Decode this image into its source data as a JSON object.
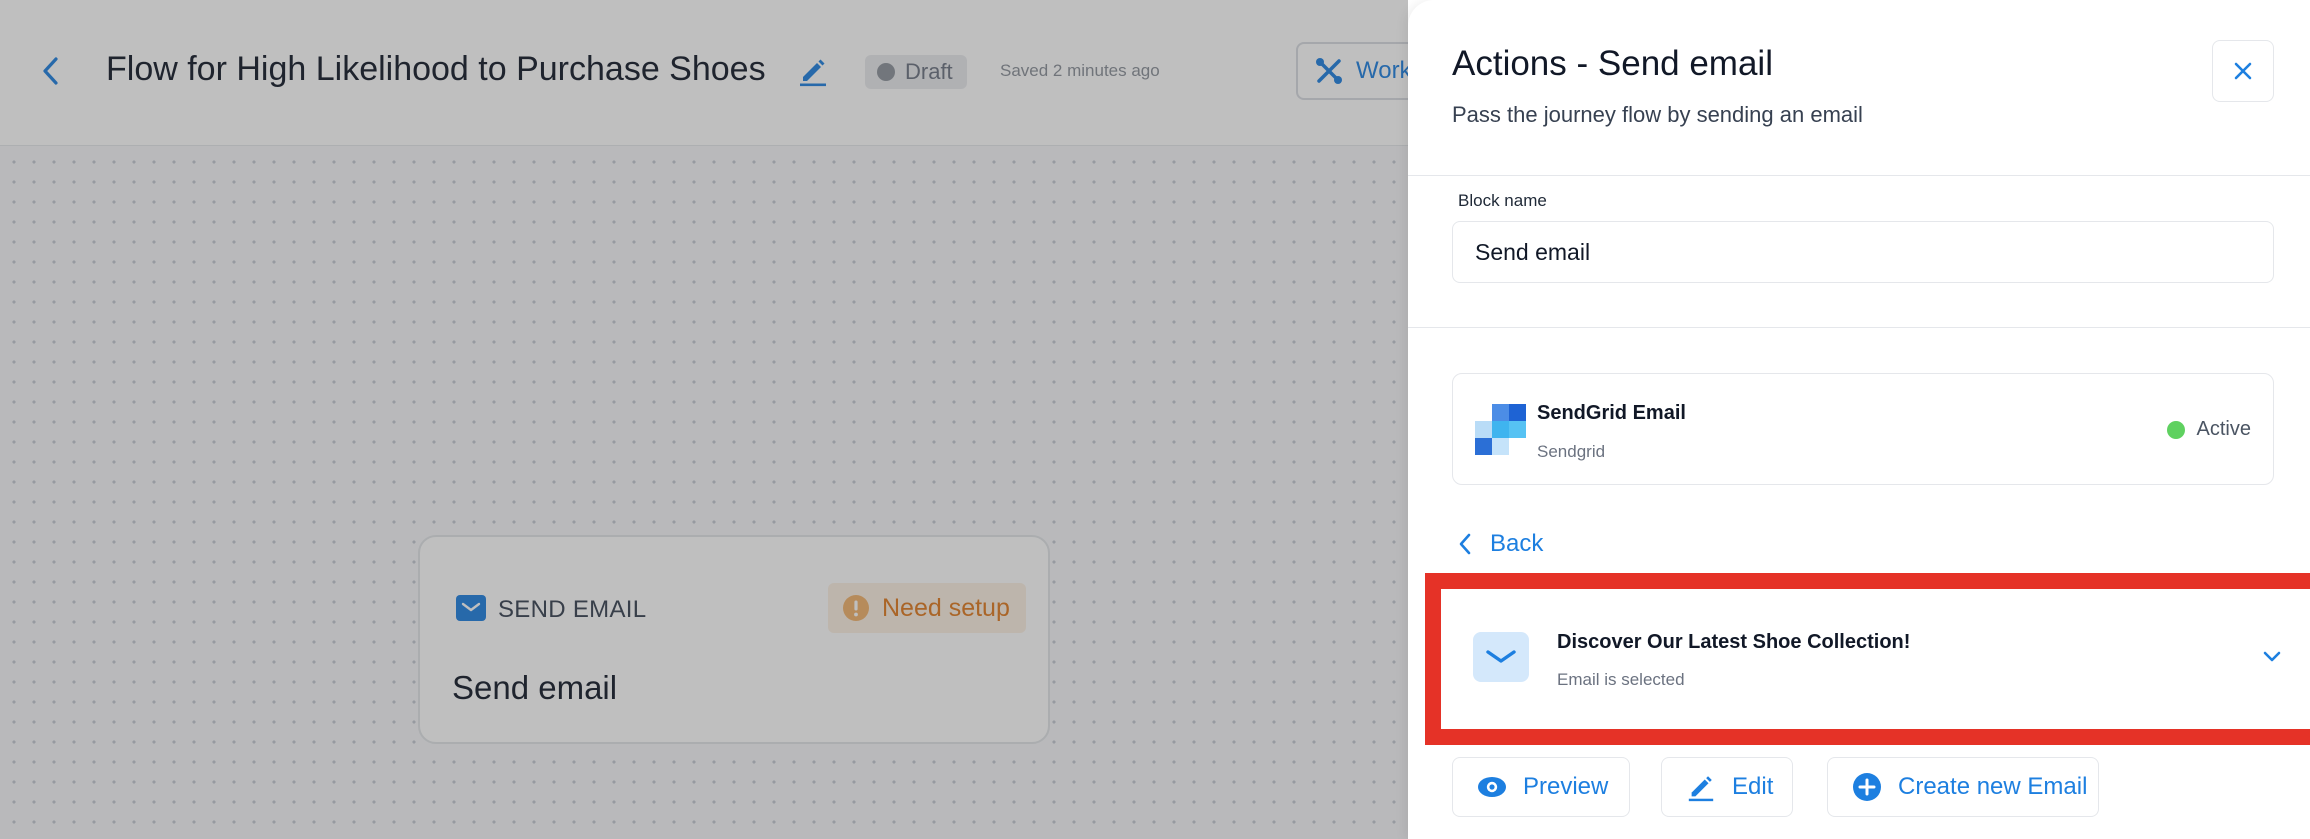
{
  "header": {
    "flow_title": "Flow for High Likelihood to Purchase Shoes",
    "status": "Draft",
    "saved_text": "Saved 2 minutes ago",
    "workflow_button": "Work"
  },
  "canvas": {
    "node": {
      "type_label": "SEND EMAIL",
      "warning_label": "Need setup",
      "name": "Send email"
    }
  },
  "panel": {
    "title": "Actions - Send email",
    "subtitle": "Pass the journey flow by sending an email",
    "block_name_label": "Block name",
    "block_name_value": "Send email",
    "provider": {
      "name": "SendGrid Email",
      "subtitle": "Sendgrid",
      "status": "Active"
    },
    "back_label": "Back",
    "selected_email": {
      "title": "Discover Our Latest Shoe Collection!",
      "subtitle": "Email is selected"
    },
    "buttons": {
      "preview": "Preview",
      "edit": "Edit",
      "create": "Create new Email"
    }
  },
  "colors": {
    "accent": "#1d7fe0",
    "highlight": "#e53227",
    "active": "#5fd160",
    "warning": "#e07a1f"
  },
  "icons": [
    "chevron-left-icon",
    "pencil-icon",
    "workflow-icon",
    "envelope-icon",
    "warning-icon",
    "close-icon",
    "sendgrid-logo",
    "chevron-down-icon",
    "eye-icon",
    "plus-circle-icon"
  ]
}
